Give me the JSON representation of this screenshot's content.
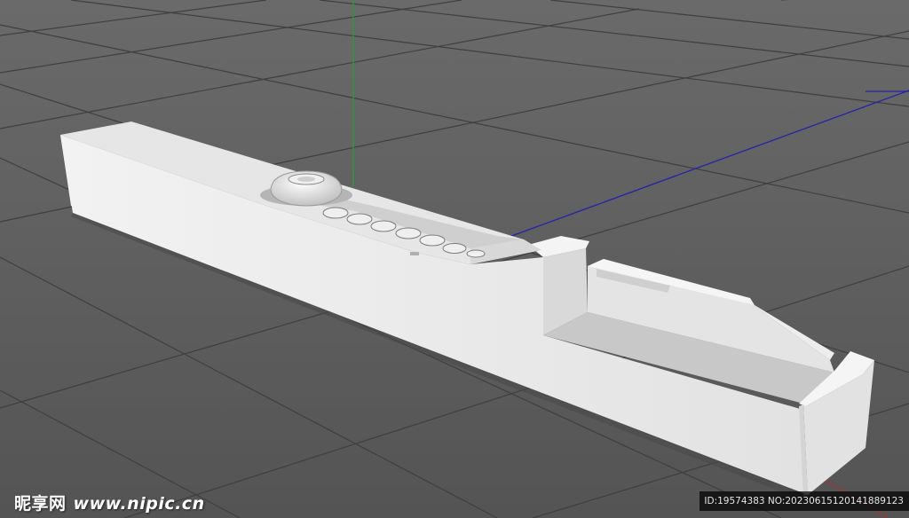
{
  "viewport": {
    "background_color": "#595959",
    "grid_color": "#3d3d3d",
    "y_axis_color": "#2f9a2f",
    "z_axis_color": "#2424a8",
    "x_axis_color": "#a83232",
    "model_color": "#ececec"
  },
  "watermark": {
    "brand": "昵享网",
    "site": "www.nipic.cn",
    "id_text": "ID:19574383 NO:20230615120141889123"
  }
}
